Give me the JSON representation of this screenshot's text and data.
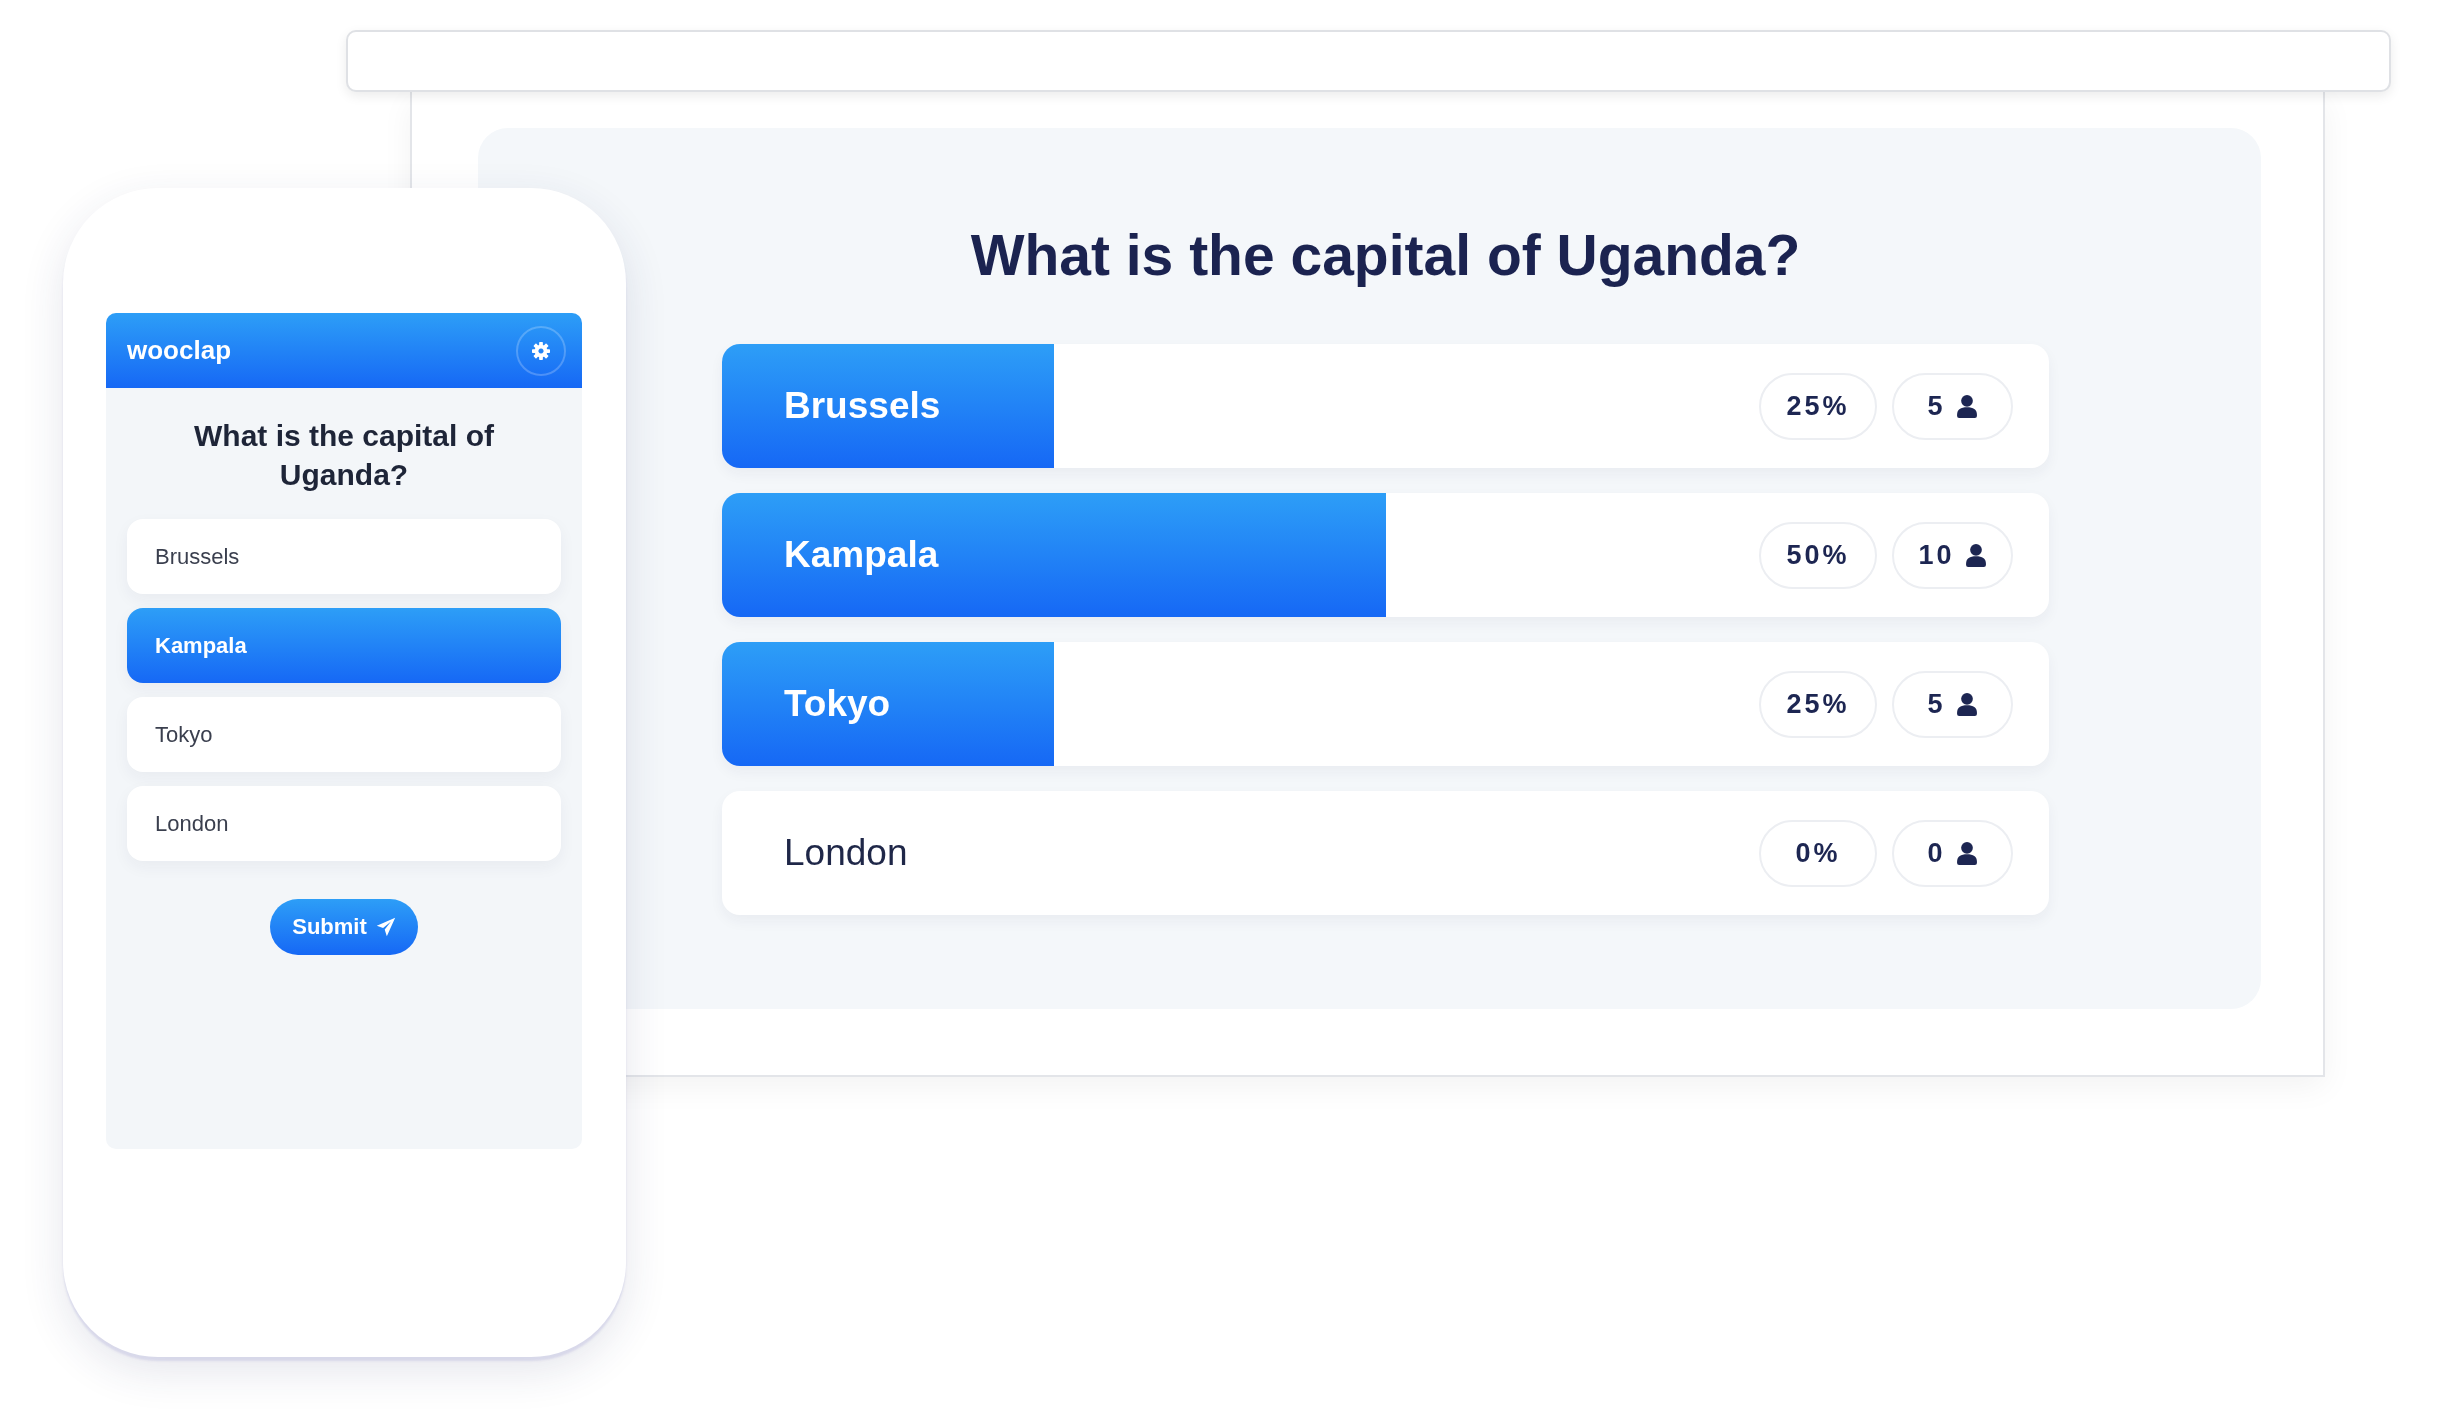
{
  "presentation": {
    "question": "What is the capital of Uganda?",
    "results": [
      {
        "label": "Brussels",
        "level": 0.25,
        "percent": "25%",
        "votes": "5"
      },
      {
        "label": "Kampala",
        "level": 0.5,
        "percent": "50%",
        "votes": "10"
      },
      {
        "label": "Tokyo",
        "level": 0.25,
        "percent": "25%",
        "votes": "5"
      },
      {
        "label": "London",
        "percent": "0%",
        "votes": "0"
      }
    ]
  },
  "phone": {
    "app_name": "wooclap",
    "question": "What is the capital of Uganda?",
    "options": [
      {
        "label": "Brussels",
        "selected": false
      },
      {
        "label": "Kampala",
        "selected": true
      },
      {
        "label": "Tokyo",
        "selected": false
      },
      {
        "label": "London",
        "selected": false
      }
    ],
    "submit_button": "Submit"
  }
}
